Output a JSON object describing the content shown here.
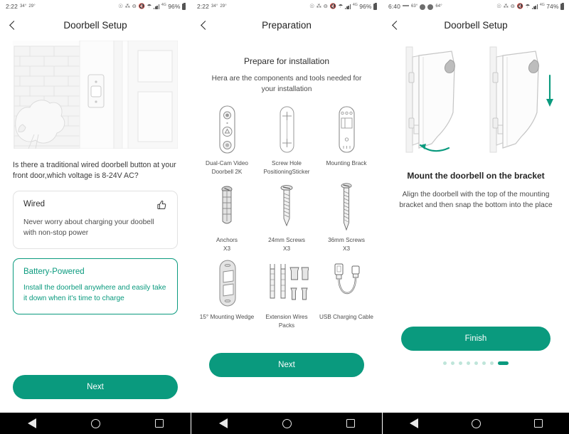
{
  "panels": [
    {
      "statusbar": {
        "time": "2:22",
        "temp_high": "34°",
        "temp_low": "29°",
        "battery": "96%",
        "network": "4G"
      },
      "title": "Doorbell Setup",
      "question": "Is there a traditional wired doorbell button at your front door,which voltage is 8-24V AC?",
      "options": [
        {
          "title": "Wired",
          "desc": "Never worry about charging your doobell with non-stop power",
          "selected": false
        },
        {
          "title": "Battery-Powered",
          "desc": "Install the doorbell anywhere and easily take it down when it's time to charge",
          "selected": true
        }
      ],
      "button_label": "Next"
    },
    {
      "statusbar": {
        "time": "2:22",
        "temp_high": "34°",
        "temp_low": "29°",
        "battery": "96%",
        "network": "4G"
      },
      "title": "Preparation",
      "heading": "Prepare for installation",
      "subheading": "Hera are the components and tools needed for your installation",
      "items": [
        {
          "line1": "Dual-Cam Video",
          "line2": "Doorbell 2K",
          "art": "doorbell"
        },
        {
          "line1": "Screw Hole",
          "line2": "PositioningSticker",
          "art": "sticker"
        },
        {
          "line1": "Mounting Brack",
          "line2": "",
          "art": "bracket"
        },
        {
          "line1": "Anchors",
          "line2": "X3",
          "art": "anchor"
        },
        {
          "line1": "24mm Screws",
          "line2": "X3",
          "art": "screw24"
        },
        {
          "line1": "36mm Screws",
          "line2": "X3",
          "art": "screw36"
        },
        {
          "line1": "15° Mounting Wedge",
          "line2": "",
          "art": "wedge"
        },
        {
          "line1": "Extension Wires",
          "line2": "Packs",
          "art": "wires"
        },
        {
          "line1": "USB Charging Cable",
          "line2": "",
          "art": "usb"
        }
      ],
      "button_label": "Next"
    },
    {
      "statusbar": {
        "time": "6:40",
        "temp_high": "63°",
        "temp_low": "64°",
        "battery": "74%",
        "network": "4G"
      },
      "title": "Doorbell Setup",
      "heading": "Mount the doorbell on the bracket",
      "subheading": "Align the doorbell with the top of the mounting bracket and then snap the bottom into the place",
      "button_label": "Finish",
      "pager": {
        "total": 8,
        "active_index": 7
      }
    }
  ],
  "android_nav": {
    "back": "back-nav-button",
    "home": "home-nav-button",
    "recents": "recents-nav-button"
  },
  "colors": {
    "accent": "#0a9a7e",
    "accent_light": "#bfe5da",
    "text": "#2c2c2c",
    "muted": "#4d4d4d"
  }
}
